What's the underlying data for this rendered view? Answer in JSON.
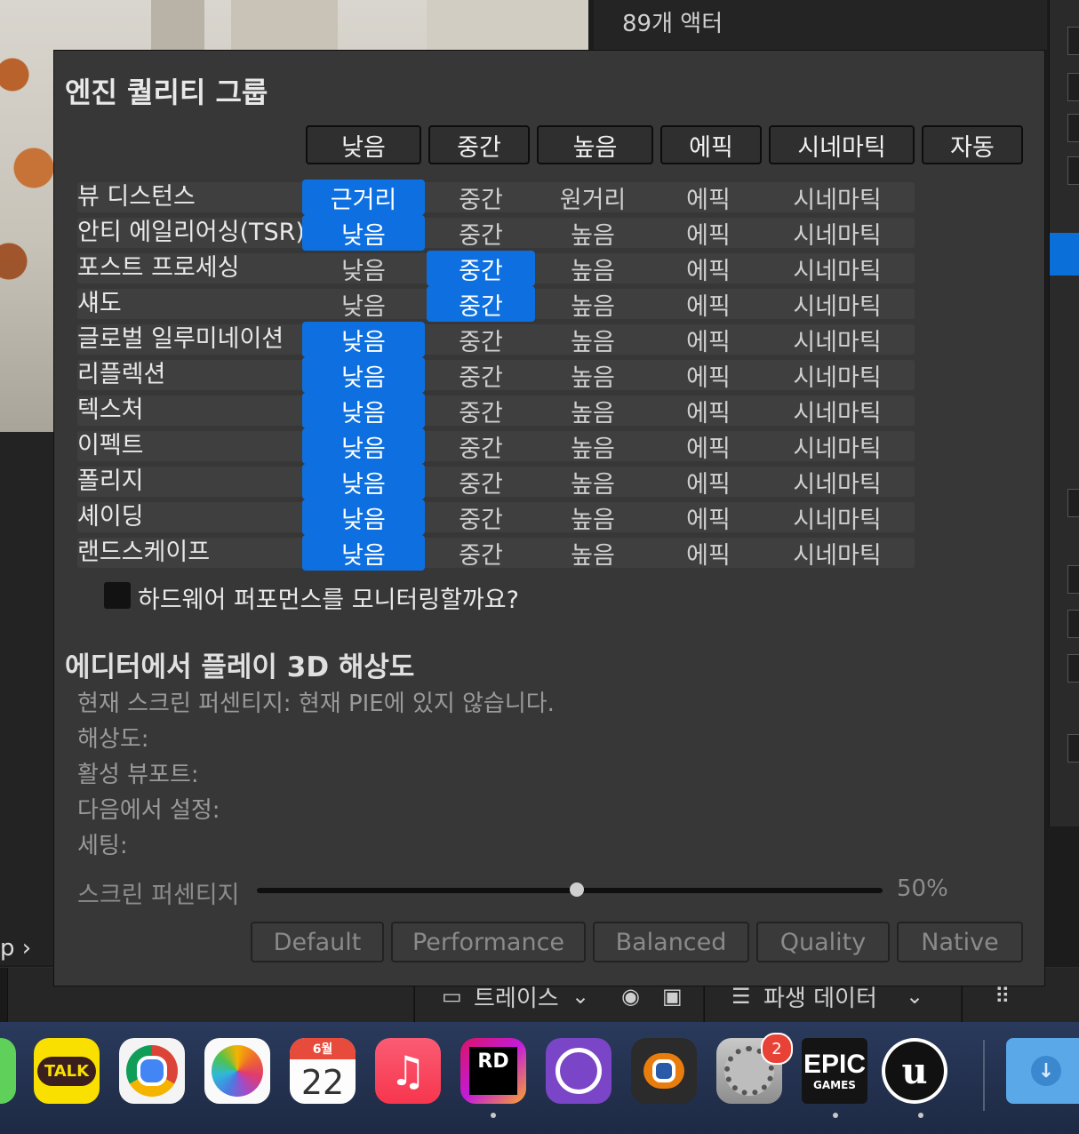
{
  "outliner": {
    "actor_count": "89개 액터"
  },
  "left_panel": {
    "crumb": "p ›"
  },
  "bottom_toolbar": {
    "trace_label": "트레이스",
    "derived_data_label": "파생 데이터"
  },
  "dialog": {
    "title": "엔진 퀄리티 그룹",
    "header_buttons": [
      "낮음",
      "중간",
      "높음",
      "에픽",
      "시네마틱",
      "자동"
    ],
    "rows": [
      {
        "label": "뷰 디스턴스",
        "options": [
          "근거리",
          "중간",
          "원거리",
          "에픽",
          "시네마틱"
        ],
        "selected": 0
      },
      {
        "label": "안티 에일리어싱(TSR)",
        "options": [
          "낮음",
          "중간",
          "높음",
          "에픽",
          "시네마틱"
        ],
        "selected": 0
      },
      {
        "label": "포스트 프로세싱",
        "options": [
          "낮음",
          "중간",
          "높음",
          "에픽",
          "시네마틱"
        ],
        "selected": 1
      },
      {
        "label": "섀도",
        "options": [
          "낮음",
          "중간",
          "높음",
          "에픽",
          "시네마틱"
        ],
        "selected": 1
      },
      {
        "label": "글로벌 일루미네이션",
        "options": [
          "낮음",
          "중간",
          "높음",
          "에픽",
          "시네마틱"
        ],
        "selected": 0
      },
      {
        "label": "리플렉션",
        "options": [
          "낮음",
          "중간",
          "높음",
          "에픽",
          "시네마틱"
        ],
        "selected": 0
      },
      {
        "label": "텍스처",
        "options": [
          "낮음",
          "중간",
          "높음",
          "에픽",
          "시네마틱"
        ],
        "selected": 0
      },
      {
        "label": "이펙트",
        "options": [
          "낮음",
          "중간",
          "높음",
          "에픽",
          "시네마틱"
        ],
        "selected": 0
      },
      {
        "label": "폴리지",
        "options": [
          "낮음",
          "중간",
          "높음",
          "에픽",
          "시네마틱"
        ],
        "selected": 0
      },
      {
        "label": "셰이딩",
        "options": [
          "낮음",
          "중간",
          "높음",
          "에픽",
          "시네마틱"
        ],
        "selected": 0
      },
      {
        "label": "랜드스케이프",
        "options": [
          "낮음",
          "중간",
          "높음",
          "에픽",
          "시네마틱"
        ],
        "selected": 0
      }
    ],
    "monitor_checkbox_label": "하드웨어 퍼포먼스를 모니터링할까요?",
    "monitor_checked": false,
    "pie_section_title": "에디터에서 플레이 3D 해상도",
    "pie_info": [
      "현재 스크린 퍼센티지: 현재 PIE에 있지 않습니다.",
      "해상도:",
      "활성 뷰포트:",
      "다음에서 설정:",
      "세팅:"
    ],
    "screen_percentage_label": "스크린 퍼센티지",
    "screen_percentage_value": "50%",
    "screen_percentage_fraction": 0.5,
    "resolution_buttons": [
      "Default",
      "Performance",
      "Balanced",
      "Quality",
      "Native"
    ]
  },
  "dock": {
    "apps": [
      "messages",
      "kakaotalk",
      "chrome",
      "photos",
      "calendar",
      "music",
      "rider",
      "github-desktop",
      "blender",
      "system-settings",
      "epic-games-launcher",
      "unreal-engine",
      "downloads"
    ],
    "kakaotalk_label": "TALK",
    "calendar_month": "6월",
    "calendar_day": "22",
    "rider_label": "RD",
    "epic_label_top": "EPIC",
    "epic_label_bottom": "GAMES",
    "settings_badge": "2"
  },
  "colors": {
    "accent": "#0e70e0",
    "dialog_bg": "#373737",
    "row_bg": "#3f3f3f"
  }
}
